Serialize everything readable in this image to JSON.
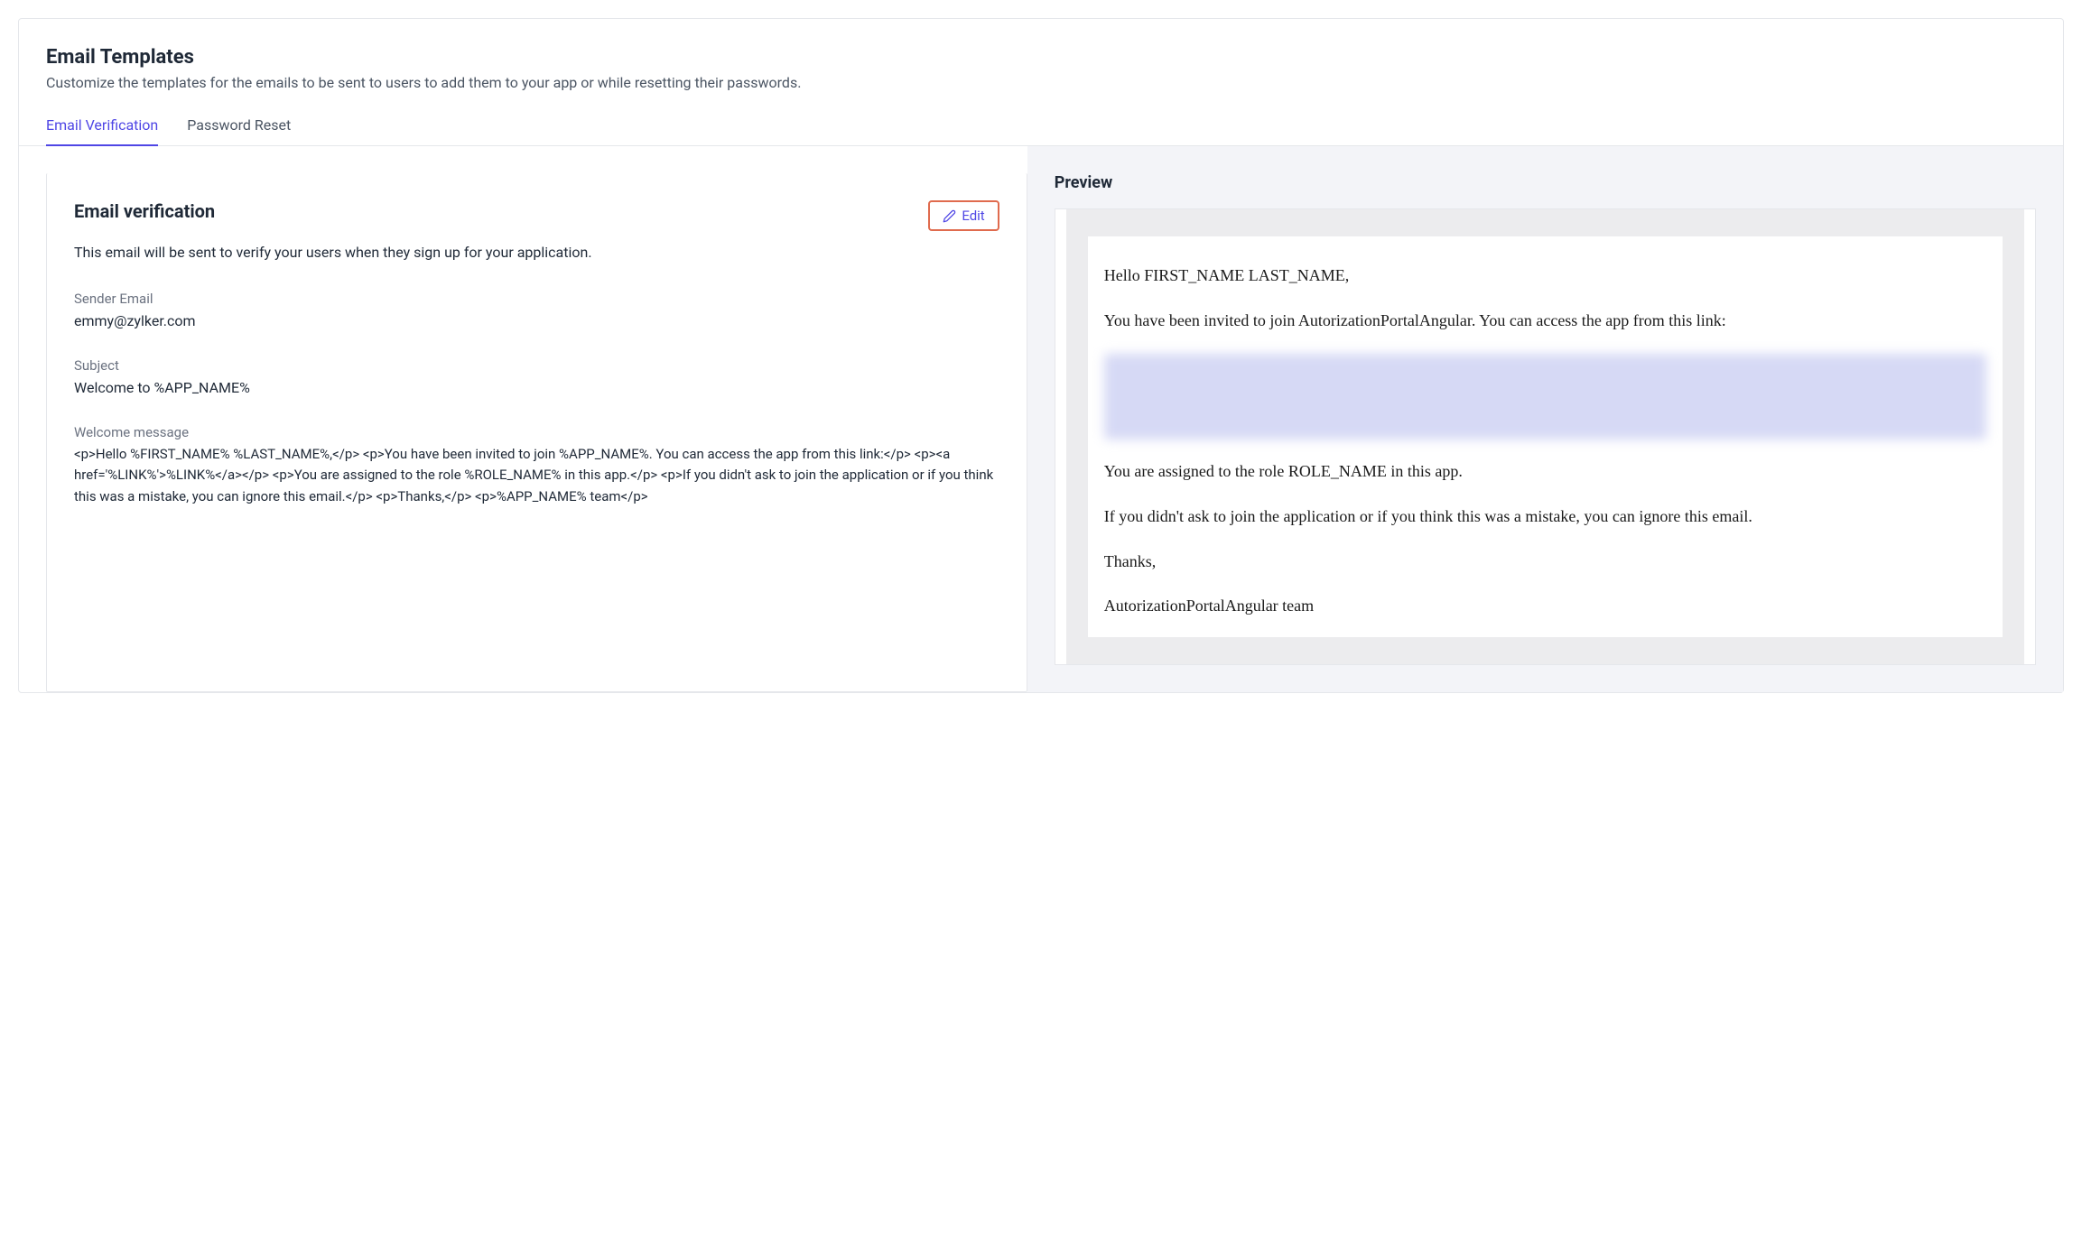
{
  "header": {
    "title": "Email Templates",
    "subtitle": "Customize the templates for the emails to be sent to users to add them to your app or while resetting their passwords."
  },
  "tabs": {
    "email_verification": "Email Verification",
    "password_reset": "Password Reset"
  },
  "left": {
    "title": "Email verification",
    "edit_label": "Edit",
    "description": "This email will be sent to verify your users when they sign up for your application.",
    "sender_email_label": "Sender Email",
    "sender_email_value": "emmy@zylker.com",
    "subject_label": "Subject",
    "subject_value": "Welcome to %APP_NAME%",
    "welcome_label": "Welcome message",
    "welcome_value": "<p>Hello %FIRST_NAME% %LAST_NAME%,</p> <p>You have been invited to join %APP_NAME%. You can access the app from this link:</p> <p><a href='%LINK%'>%LINK%</a></p> <p>You are assigned to the role %ROLE_NAME% in this app.</p> <p>If you didn't ask to join the application or if you think this was a mistake, you can ignore this email.</p> <p>Thanks,</p> <p>%APP_NAME% team</p>"
  },
  "preview": {
    "title": "Preview",
    "greeting": "Hello FIRST_NAME LAST_NAME,",
    "invite_line": "You have been invited to join AutorizationPortalAngular. You can access the app from this link:",
    "role_line": "You are assigned to the role ROLE_NAME in this app.",
    "ignore_line": "If you didn't ask to join the application or if you think this was a mistake, you can ignore this email.",
    "thanks": "Thanks,",
    "team": "AutorizationPortalAngular team"
  }
}
